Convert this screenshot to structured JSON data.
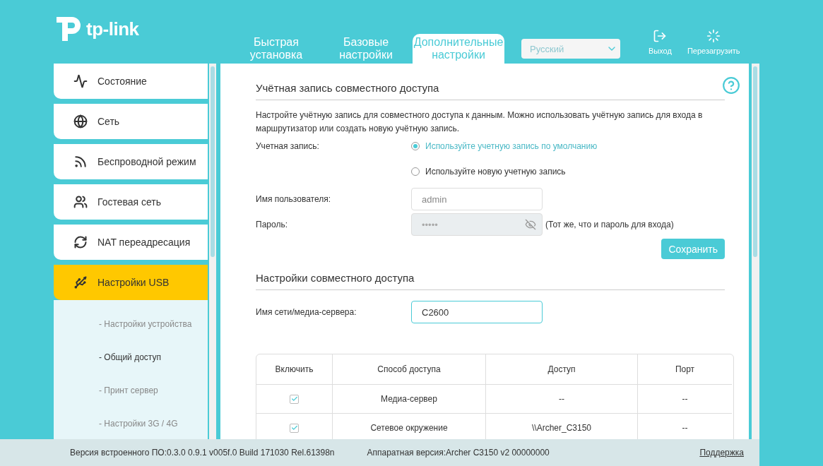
{
  "logo": {
    "text": "tp-link"
  },
  "nav_tabs": [
    {
      "label": "Быстрая установка",
      "selected": false
    },
    {
      "label": "Базовые настройки",
      "selected": false
    },
    {
      "label": "Дополнительные настройки",
      "selected": true
    }
  ],
  "language": {
    "value": "Русский"
  },
  "header_actions": [
    {
      "kind": "logout",
      "label": "Выход"
    },
    {
      "kind": "reboot",
      "label": "Перезагрузить"
    }
  ],
  "sidebar": {
    "items": [
      {
        "kind": "status",
        "label": "Состояние",
        "selected": false
      },
      {
        "kind": "network",
        "label": "Сеть",
        "selected": false
      },
      {
        "kind": "wireless",
        "label": "Беспроводной режим",
        "selected": false
      },
      {
        "kind": "guest",
        "label": "Гостевая сеть",
        "selected": false
      },
      {
        "kind": "nat",
        "label": "NAT переадресация",
        "selected": false
      },
      {
        "kind": "usb",
        "label": "Настройки USB",
        "selected": true,
        "children": [
          {
            "label": "- Настройки устройства",
            "selected": false
          },
          {
            "label": "- Общий доступ",
            "selected": true
          },
          {
            "label": "- Принт сервер",
            "selected": false
          },
          {
            "label": "- Настройки 3G / 4G",
            "selected": false
          }
        ]
      }
    ]
  },
  "account_section": {
    "title": "Учётная запись совместного доступа",
    "description": "Настройте учётную запись для совместного доступа к данным. Можно использовать учётную запись для входа в маршрутизатор или создать новую учётную запись.",
    "account_label": "Учетная запись:",
    "options": [
      {
        "label": "Используйте учетную запись по умолчанию",
        "selected": true
      },
      {
        "label": "Используйте новую учетную запись",
        "selected": false
      }
    ],
    "username": {
      "label": "Имя пользователя:",
      "value": "admin"
    },
    "password": {
      "label": "Пароль:",
      "value": "•••••",
      "disabled": true,
      "note": "(Тот же, что и пароль для входа)"
    },
    "save_button": "Сохранить"
  },
  "sharing_section": {
    "title": "Настройки совместного доступа",
    "server_name": {
      "label": "Имя сети/медиа-сервера:",
      "value": "C2600"
    },
    "table": {
      "columns": [
        "Включить",
        "Способ доступа",
        "Доступ",
        "Порт"
      ],
      "rows": [
        {
          "enabled": true,
          "method": "Медиа-сервер",
          "access": "--",
          "port": "--"
        },
        {
          "enabled": true,
          "method": "Сетевое окружение",
          "access": "\\\\Archer_C3150",
          "port": "--"
        }
      ]
    }
  },
  "footer": {
    "firmware": "Версия встроенного ПО:0.3.0 0.9.1 v005f.0 Build 171030 Rel.61398n",
    "hardware": "Аппаратная версия:Archer C3150 v2 00000000",
    "support_link": "Поддержка"
  }
}
